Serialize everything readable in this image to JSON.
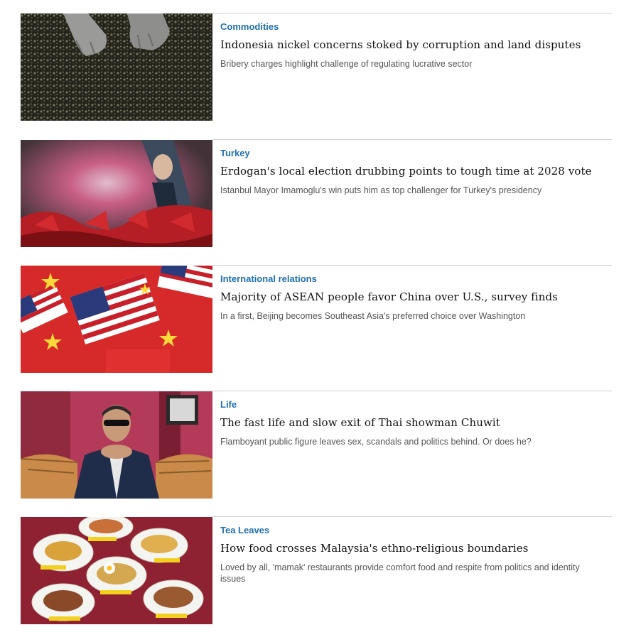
{
  "articles": [
    {
      "category": "Commodities",
      "headline": "Indonesia nickel concerns stoked by corruption and land disputes",
      "summary": "Bribery charges highlight challenge of regulating lucrative sector"
    },
    {
      "category": "Turkey",
      "headline": "Erdogan's local election drubbing points to tough time at 2028 vote",
      "summary": "Istanbul Mayor Imamoglu's win puts him as top challenger for Turkey's presidency"
    },
    {
      "category": "International relations",
      "headline": "Majority of ASEAN people favor China over U.S., survey finds",
      "summary": "In a first, Beijing becomes Southeast Asia's preferred choice over Washington"
    },
    {
      "category": "Life",
      "headline": "The fast life and slow exit of Thai showman Chuwit",
      "summary": "Flamboyant public figure leaves sex, scandals and politics behind. Or does he?"
    },
    {
      "category": "Tea Leaves",
      "headline": "How food crosses Malaysia's ethno-religious boundaries",
      "summary": "Loved by all, 'mamak' restaurants provide comfort food and respite from politics and identity issues"
    }
  ],
  "colors": {
    "category": "#1f6fb2",
    "headline": "#111111",
    "summary": "#555555",
    "divider": "#cfcfcf"
  }
}
